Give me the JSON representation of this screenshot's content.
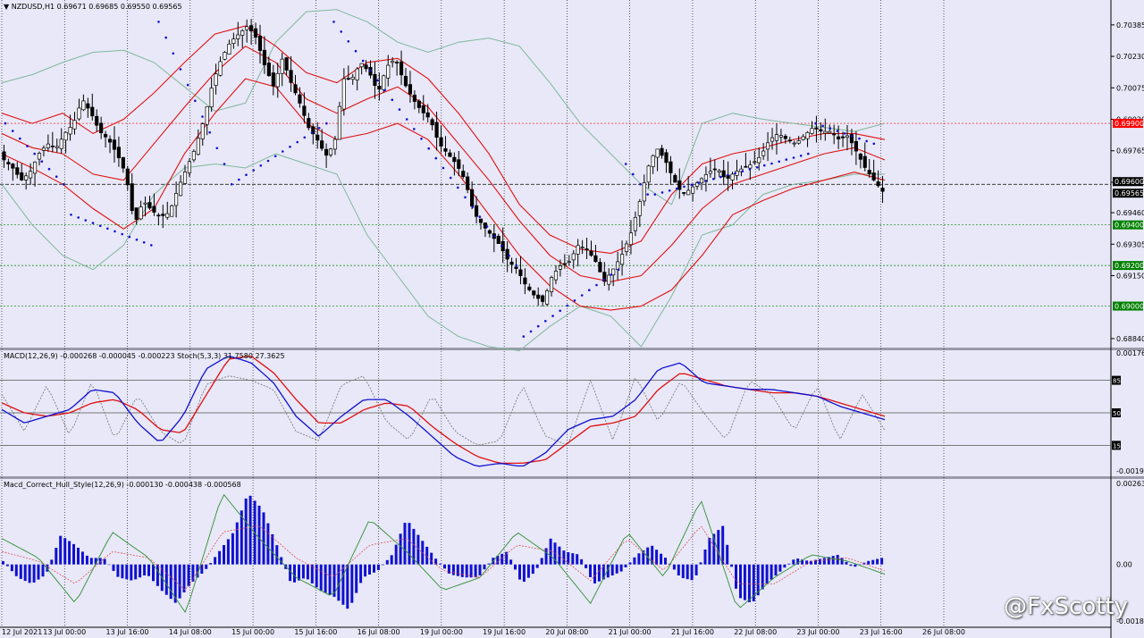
{
  "colors": {
    "background": "#e8e8f8",
    "grid": "#000000",
    "bollinger_outer": "#7fb89a",
    "bollinger_inner": "#e01010",
    "sar": "#1010d0",
    "macd_main": "#1010d0",
    "macd_signal": "#e01010",
    "stoch": "#707070",
    "hist": "#1010d0",
    "hull_signal_a": "#2f8f2f",
    "hull_signal_b": "#e05050",
    "tag_red": "#ff0000",
    "tag_green": "#008000",
    "tag_black": "#000000"
  },
  "chart_data": [
    {
      "type": "candlestick",
      "title": "NZDUSD,H1  0.69671 0.69685 0.69550 0.69565",
      "symbol": "NZDUSD,H1",
      "ohlc_header": [
        "0.69671",
        "0.69685",
        "0.69550",
        "0.69565"
      ],
      "ylim": [
        0.688,
        0.7049
      ],
      "yticks": [
        "0.70385",
        "0.70230",
        "0.70075",
        "0.69920",
        "0.69765",
        "0.69610",
        "0.69460",
        "0.69305",
        "0.69150",
        "0.68840"
      ],
      "x_labels": [
        "12 Jul 2021",
        "13 Jul 00:00",
        "13 Jul 16:00",
        "14 Jul 08:00",
        "15 Jul 00:00",
        "15 Jul 16:00",
        "16 Jul 08:00",
        "19 Jul 00:00",
        "19 Jul 16:00",
        "20 Jul 08:00",
        "21 Jul 00:00",
        "21 Jul 16:00",
        "22 Jul 08:00",
        "23 Jul 00:00",
        "23 Jul 16:00",
        "26 Jul 08:00"
      ],
      "close_path": [
        0.6972,
        0.6968,
        0.6962,
        0.6966,
        0.6975,
        0.698,
        0.6978,
        0.6985,
        0.699,
        0.7002,
        0.6995,
        0.6986,
        0.6982,
        0.6975,
        0.6965,
        0.694,
        0.6952,
        0.6947,
        0.6944,
        0.6946,
        0.6958,
        0.6968,
        0.6978,
        0.6992,
        0.701,
        0.7022,
        0.703,
        0.7034,
        0.7038,
        0.7032,
        0.7018,
        0.7008,
        0.7022,
        0.701,
        0.7,
        0.6988,
        0.6982,
        0.6974,
        0.698,
        0.7012,
        0.7012,
        0.702,
        0.7015,
        0.7005,
        0.7018,
        0.7022,
        0.701,
        0.7002,
        0.6996,
        0.6992,
        0.698,
        0.6975,
        0.697,
        0.6962,
        0.6946,
        0.694,
        0.6935,
        0.693,
        0.6922,
        0.6918,
        0.691,
        0.6905,
        0.6902,
        0.6915,
        0.692,
        0.6922,
        0.693,
        0.6928,
        0.6922,
        0.6912,
        0.6918,
        0.6925,
        0.6935,
        0.695,
        0.6968,
        0.6978,
        0.6972,
        0.6962,
        0.6955,
        0.6958,
        0.6962,
        0.6966,
        0.6968,
        0.6962,
        0.6966,
        0.6968,
        0.697,
        0.6974,
        0.6982,
        0.6985,
        0.6982,
        0.698,
        0.6984,
        0.6988,
        0.6986,
        0.6986,
        0.6982,
        0.6984,
        0.6976,
        0.6968,
        0.6962,
        0.69565
      ],
      "bollinger_outer_upper": [
        0.701,
        0.7014,
        0.702,
        0.7025,
        0.7026,
        0.702,
        0.7008,
        0.6996,
        0.7,
        0.703,
        0.7045,
        0.7046,
        0.704,
        0.703,
        0.7025,
        0.703,
        0.7032,
        0.7028,
        0.701,
        0.699,
        0.6975,
        0.696,
        0.695,
        0.699,
        0.6995,
        0.6992,
        0.699,
        0.6988,
        0.6986,
        0.699
      ],
      "bollinger_outer_lower": [
        0.696,
        0.694,
        0.6925,
        0.6918,
        0.693,
        0.6955,
        0.6968,
        0.697,
        0.6968,
        0.6975,
        0.697,
        0.6965,
        0.6935,
        0.6915,
        0.6895,
        0.6885,
        0.688,
        0.6878,
        0.689,
        0.69,
        0.6895,
        0.688,
        0.6905,
        0.6935,
        0.694,
        0.6955,
        0.696,
        0.6962,
        0.6965,
        0.6965
      ],
      "bollinger_inner_upper": [
        0.6995,
        0.699,
        0.6995,
        0.6985,
        0.6992,
        0.7005,
        0.702,
        0.7034,
        0.7038,
        0.7028,
        0.7015,
        0.701,
        0.702,
        0.7022,
        0.7012,
        0.6995,
        0.6975,
        0.695,
        0.6935,
        0.6928,
        0.6926,
        0.6932,
        0.6955,
        0.697,
        0.6975,
        0.6978,
        0.6982,
        0.6985,
        0.6985,
        0.6982
      ],
      "bollinger_mid": [
        0.6985,
        0.6978,
        0.6975,
        0.6965,
        0.6962,
        0.698,
        0.6998,
        0.7015,
        0.7028,
        0.702,
        0.7002,
        0.6995,
        0.7002,
        0.7008,
        0.6998,
        0.698,
        0.6962,
        0.6942,
        0.6925,
        0.6915,
        0.6912,
        0.6915,
        0.693,
        0.6948,
        0.696,
        0.6965,
        0.697,
        0.6975,
        0.6978,
        0.6972
      ],
      "bollinger_inner_lower": [
        0.6975,
        0.6968,
        0.696,
        0.6948,
        0.6938,
        0.6948,
        0.6975,
        0.6995,
        0.7012,
        0.7008,
        0.699,
        0.6982,
        0.6985,
        0.699,
        0.6982,
        0.6965,
        0.6945,
        0.6925,
        0.691,
        0.69,
        0.6898,
        0.69,
        0.6908,
        0.6925,
        0.6945,
        0.6952,
        0.6958,
        0.6962,
        0.6966,
        0.6962
      ],
      "sar_segments": [
        {
          "from": [
            0.699,
            0.696
          ],
          "dir": "down",
          "count": 9
        },
        {
          "from": [
            0.6945,
            0.693
          ],
          "dir": "up",
          "count": 12
        },
        {
          "from": [
            0.704,
            0.697
          ],
          "dir": "down",
          "count": 10
        },
        {
          "from": [
            0.696,
            0.699
          ],
          "dir": "up",
          "count": 14
        },
        {
          "from": [
            0.704,
            0.692
          ],
          "dir": "down",
          "count": 26
        },
        {
          "from": [
            0.6885,
            0.6918
          ],
          "dir": "up",
          "count": 14
        },
        {
          "from": [
            0.697,
            0.6955
          ],
          "dir": "down",
          "count": 4
        },
        {
          "from": [
            0.6955,
            0.6975
          ],
          "dir": "up",
          "count": 22
        },
        {
          "from": [
            0.699,
            0.698
          ],
          "dir": "down",
          "count": 9
        }
      ],
      "price_tags": [
        {
          "value": "0.69900",
          "color": "red"
        },
        {
          "value": "0.69600",
          "color": "black"
        },
        {
          "value": "0.69565",
          "color": "black"
        },
        {
          "value": "0.69400",
          "color": "green"
        },
        {
          "value": "0.69200",
          "color": "green"
        },
        {
          "value": "0.69000",
          "color": "green"
        }
      ],
      "price_tag_levels": [
        0.699,
        0.696,
        0.69565,
        0.694,
        0.692,
        0.69
      ]
    },
    {
      "type": "line",
      "title": "MACD(12,26,9) -0.000268 -0.000045 -0.000223  Stoch(5,3,3) 31.7580 27.3625",
      "ylim": [
        -0.001961,
        0.001766
      ],
      "yticks": [
        "0.001766",
        "-0.001961"
      ],
      "stoch_levels": [
        85,
        50,
        15
      ],
      "stoch_level_labels": [
        "85",
        "50",
        "15"
      ],
      "macd_main": [
        0.0,
        -0.0004,
        -0.0002,
        0.0,
        0.0006,
        0.0005,
        -0.0004,
        -0.001,
        -0.0002,
        0.0012,
        0.0016,
        0.0014,
        0.0008,
        -0.0002,
        -0.0008,
        -0.0002,
        0.0003,
        0.0003,
        -0.0002,
        -0.0008,
        -0.0014,
        -0.0017,
        -0.0016,
        -0.0017,
        -0.0013,
        -0.0006,
        -0.0003,
        -0.0002,
        0.0003,
        0.0012,
        0.0014,
        0.0008,
        0.0007,
        0.0006,
        0.0006,
        0.0005,
        0.0004,
        0.0001,
        -0.0001,
        -0.0003
      ],
      "macd_signal": [
        0.0002,
        -0.0001,
        -0.0002,
        -0.0001,
        0.0002,
        0.0003,
        0.0,
        -0.0006,
        -0.0007,
        0.0004,
        0.0015,
        0.0016,
        0.0011,
        0.0003,
        -0.0004,
        -0.0004,
        0.0,
        0.0002,
        0.0001,
        -0.0005,
        -0.001,
        -0.0014,
        -0.0016,
        -0.0016,
        -0.0015,
        -0.001,
        -0.0005,
        -0.0004,
        -0.0002,
        0.0006,
        0.0011,
        0.0009,
        0.0007,
        0.0006,
        0.0005,
        0.0005,
        0.0004,
        0.0002,
        0.0,
        -0.0002
      ],
      "stoch": [
        70,
        30,
        80,
        25,
        85,
        20,
        70,
        30,
        15,
        80,
        90,
        85,
        75,
        30,
        20,
        80,
        90,
        40,
        20,
        70,
        30,
        15,
        20,
        80,
        25,
        15,
        85,
        20,
        90,
        40,
        85,
        50,
        20,
        85,
        70,
        30,
        80,
        20,
        70,
        31
      ]
    },
    {
      "type": "bar",
      "title": "Macd_Correct_Hull_Style(12,26,9) -0.000130 -0.000438 -0.000568",
      "ylim": [
        -0.001881,
        0.002635
      ],
      "yticks": [
        "0.002635",
        "0.00",
        "-0.001881"
      ],
      "histogram": [
        0.0001,
        -0.0004,
        -0.0006,
        -0.0003,
        0.0009,
        0.0006,
        0.0002,
        0.0002,
        -0.0004,
        -0.0005,
        -0.0003,
        -0.0008,
        -0.0012,
        -0.0006,
        -0.0002,
        0.0004,
        0.001,
        0.0022,
        0.0017,
        0.0006,
        -0.0006,
        -0.0004,
        -0.0008,
        -0.001,
        -0.0014,
        -0.0004,
        -0.0002,
        0.0003,
        0.0014,
        0.0008,
        0.0002,
        -0.0003,
        -0.0004,
        -0.0004,
        0.0002,
        0.0004,
        -0.0006,
        -0.0002,
        0.0008,
        0.0004,
        0.0003,
        -0.0006,
        -0.0004,
        -0.0002,
        0.0003,
        0.0006,
        0.0002,
        -0.0004,
        -0.0005,
        0.0008,
        0.0012,
        -0.001,
        -0.0012,
        -0.0006,
        -0.0002,
        0.0002,
        0.0001,
        0.0002,
        0.0003,
        -0.0001,
        0.0001,
        0.0002
      ],
      "hull_a": [
        0.0008,
        0.0002,
        -0.0012,
        0.001,
        0.0002,
        -0.0015,
        0.0022,
        0.0008,
        -0.0004,
        -0.001,
        0.0014,
        0.0004,
        -0.0008,
        -0.0004,
        0.001,
        0.0002,
        -0.0012,
        0.001,
        -0.0004,
        0.002,
        -0.0014,
        -0.0004,
        0.0003,
        0.0001,
        -0.0003
      ],
      "hull_b": [
        0.0004,
        0.0001,
        -0.0006,
        0.0004,
        0.0002,
        -0.0008,
        0.001,
        0.0012,
        0.0002,
        -0.0004,
        0.0006,
        0.0008,
        -0.0002,
        -0.0004,
        0.0006,
        0.0004,
        -0.0005,
        0.0008,
        -0.0002,
        0.0012,
        -0.0006,
        -0.0006,
        0.0001,
        0.0002,
        -0.0002
      ]
    }
  ],
  "watermark": "@FxScotty"
}
